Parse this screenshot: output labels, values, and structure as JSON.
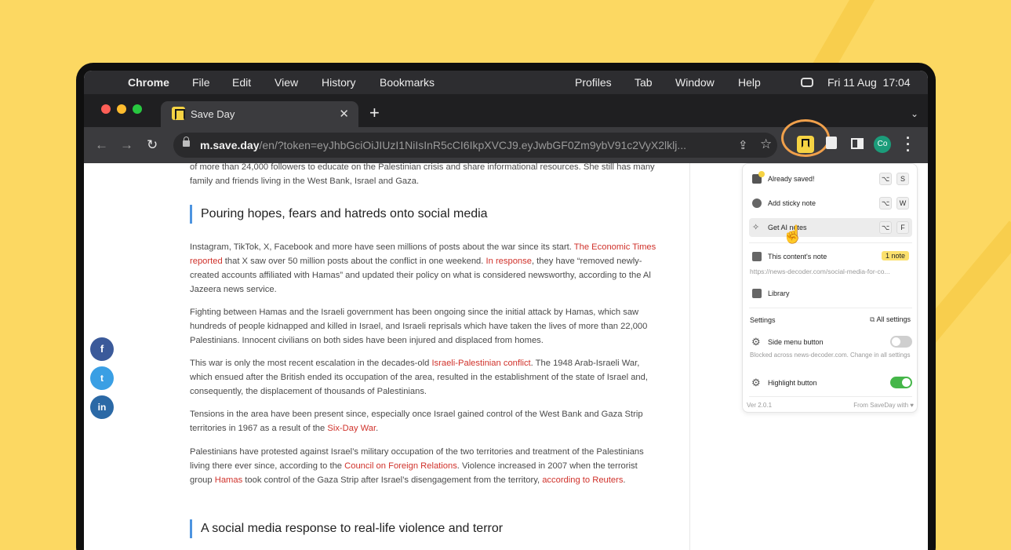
{
  "menubar": {
    "app": "Chrome",
    "items": [
      "File",
      "Edit",
      "View",
      "History",
      "Bookmarks",
      "Profiles",
      "Tab",
      "Window",
      "Help"
    ],
    "datetime": "Fri 11 Aug  17:04",
    "apple_icon": "apple-icon",
    "control_icon": "control-center-icon"
  },
  "tab": {
    "title": "Save Day",
    "close": "✕",
    "new": "+"
  },
  "toolbar": {
    "back": "←",
    "forward": "→",
    "reload": "↻",
    "url_host": "m.save.day",
    "url_rest": "/en/?token=eyJhbGciOiJIUzI1NiIsInR5cCI6IkpXVCJ9.eyJwbGF0Zm9ybV91c2VyX2lklj...",
    "share": "⇪",
    "star": "☆",
    "avatar": "Co"
  },
  "article": {
    "intro": "of more than 24,000 followers to educate on the Palestinian crisis and share informational resources. She still has many family and friends living in the West Bank, Israel and Gaza.",
    "h1": "Pouring hopes, fears and hatreds onto social media",
    "p1a": "Instagram, TikTok, X, Facebook and more have seen millions of posts about the war since its start. ",
    "p1_link1": "The Economic Times reported",
    "p1b": " that X saw over 50 million posts about the conflict in one weekend. ",
    "p1_link2": "In response",
    "p1c": ", they have “removed newly-created accounts affiliated with Hamas” and updated their policy on what is considered newsworthy, according to the Al Jazeera news service.",
    "p2": "Fighting between Hamas and the Israeli government has been ongoing since the initial attack by Hamas, which saw hundreds of people kidnapped and killed in Israel, and Israeli reprisals which have taken the lives of more than 22,000 Palestinians. Innocent civilians on both sides have been injured and displaced from homes.",
    "p3a": "This war is only the most recent escalation in the decades-old ",
    "p3_link": "Israeli-Palestinian conflict",
    "p3b": ". The 1948 Arab-Israeli War, which ensued after the British ended its occupation of the area, resulted in the establishment of the state of Israel and, consequently, the displacement of thousands of Palestinians.",
    "p4a": "Tensions in the area have been present since, especially once Israel gained control of the West Bank and Gaza Strip territories in 1967 as a result of the ",
    "p4_link": "Six-Day War",
    "p4b": ".",
    "p5a": "Palestinians have protested against Israel’s military occupation of the two territories and treatment of the Palestinians living there ever since, according to the ",
    "p5_link1": "Council on Foreign Relations",
    "p5b": ". Violence increased in 2007 when the terrorist group ",
    "p5_link2": "Hamas",
    "p5c": " took control of the Gaza Strip after Israel’s disengagement from the territory, ",
    "p5_link3": "according to Reuters",
    "p5d": ".",
    "h2": "A social media response to real-life violence and terror"
  },
  "social": {
    "facebook": "f",
    "twitter": "🐦",
    "linkedin": "in"
  },
  "popup": {
    "already_saved": "Already saved!",
    "already_saved_keys": [
      "⌥",
      "S"
    ],
    "sticky": "Add sticky note",
    "sticky_keys": [
      "⌥",
      "W"
    ],
    "ai": "Get AI notes",
    "ai_keys": [
      "⌥",
      "F"
    ],
    "content_note": "This content's note",
    "note_badge": "1 note",
    "note_url": "https://news-decoder.com/social-media-for-co...",
    "library": "Library",
    "settings": "Settings",
    "all_settings": "All settings",
    "side_menu": "Side menu button",
    "side_menu_desc": "Blocked across news-decoder.com. Change in all settings",
    "highlight": "Highlight button",
    "version": "Ver 2.0.1",
    "from": "From SaveDay with ♥"
  },
  "colors": {
    "background": "#fcd862",
    "link": "#d0322b",
    "accent_ring": "#f0a04b",
    "brand_yellow": "#f6d343",
    "toggle_on": "#45b649"
  }
}
